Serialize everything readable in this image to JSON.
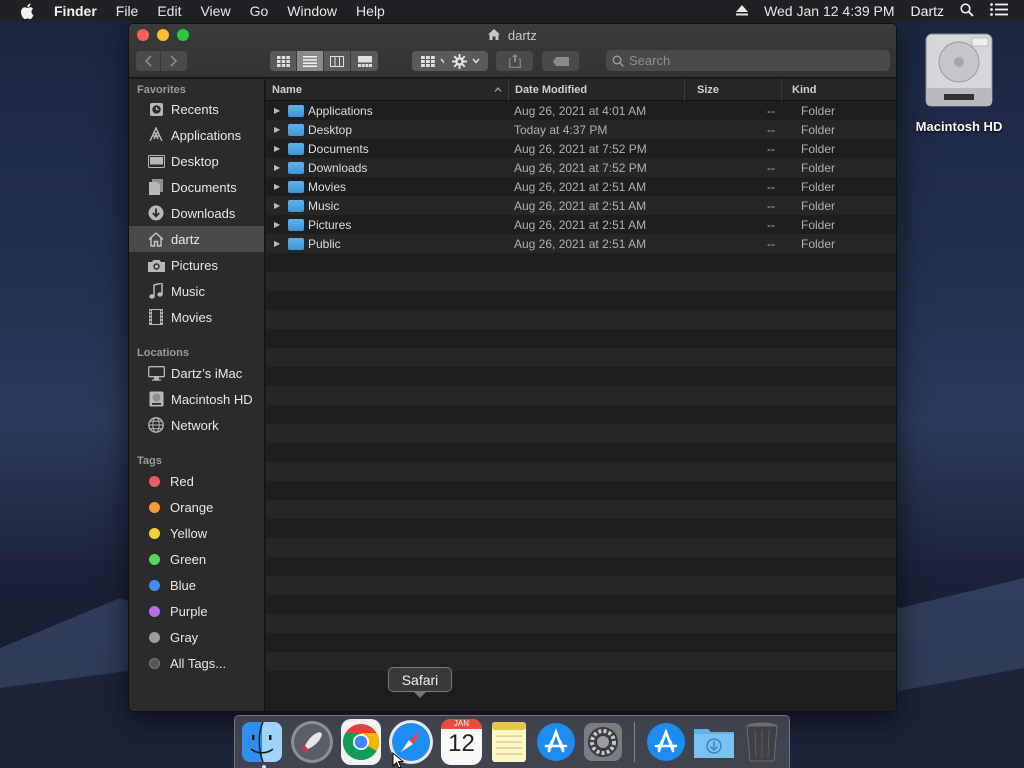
{
  "menubar": {
    "app": "Finder",
    "items": [
      "File",
      "Edit",
      "View",
      "Go",
      "Window",
      "Help"
    ],
    "clock": "Wed Jan 12  4:39 PM",
    "user": "Dartz"
  },
  "window": {
    "title": "dartz",
    "search_placeholder": "Search"
  },
  "sidebar": {
    "favorites_label": "Favorites",
    "favorites": [
      {
        "label": "Recents",
        "icon": "clock-icon"
      },
      {
        "label": "Applications",
        "icon": "applications-icon"
      },
      {
        "label": "Desktop",
        "icon": "desktop-icon"
      },
      {
        "label": "Documents",
        "icon": "document-icon"
      },
      {
        "label": "Downloads",
        "icon": "download-icon"
      },
      {
        "label": "dartz",
        "icon": "home-icon"
      },
      {
        "label": "Pictures",
        "icon": "camera-icon"
      },
      {
        "label": "Music",
        "icon": "music-note-icon"
      },
      {
        "label": "Movies",
        "icon": "film-icon"
      }
    ],
    "locations_label": "Locations",
    "locations": [
      {
        "label": "Dartz’s iMac",
        "icon": "imac-icon"
      },
      {
        "label": "Macintosh HD",
        "icon": "disk-icon"
      },
      {
        "label": "Network",
        "icon": "globe-icon"
      }
    ],
    "tags_label": "Tags",
    "tags": [
      {
        "label": "Red",
        "color": "#ec5c5c"
      },
      {
        "label": "Orange",
        "color": "#f39c3b"
      },
      {
        "label": "Yellow",
        "color": "#f4d03a"
      },
      {
        "label": "Green",
        "color": "#5bd55b"
      },
      {
        "label": "Blue",
        "color": "#3f8ef0"
      },
      {
        "label": "Purple",
        "color": "#b76ee8"
      },
      {
        "label": "Gray",
        "color": "#9c9ca0"
      },
      {
        "label": "All Tags...",
        "color": "#555558"
      }
    ]
  },
  "list": {
    "columns": {
      "name": "Name",
      "date": "Date Modified",
      "size": "Size",
      "kind": "Kind"
    },
    "rows": [
      {
        "name": "Applications",
        "date": "Aug 26, 2021 at 4:01 AM",
        "size": "--",
        "kind": "Folder"
      },
      {
        "name": "Desktop",
        "date": "Today at 4:37 PM",
        "size": "--",
        "kind": "Folder"
      },
      {
        "name": "Documents",
        "date": "Aug 26, 2021 at 7:52 PM",
        "size": "--",
        "kind": "Folder"
      },
      {
        "name": "Downloads",
        "date": "Aug 26, 2021 at 7:52 PM",
        "size": "--",
        "kind": "Folder"
      },
      {
        "name": "Movies",
        "date": "Aug 26, 2021 at 2:51 AM",
        "size": "--",
        "kind": "Folder"
      },
      {
        "name": "Music",
        "date": "Aug 26, 2021 at 2:51 AM",
        "size": "--",
        "kind": "Folder"
      },
      {
        "name": "Pictures",
        "date": "Aug 26, 2021 at 2:51 AM",
        "size": "--",
        "kind": "Folder"
      },
      {
        "name": "Public",
        "date": "Aug 26, 2021 at 2:51 AM",
        "size": "--",
        "kind": "Folder"
      }
    ]
  },
  "desktop": {
    "hd_label": "Macintosh HD"
  },
  "dock": {
    "tooltip": "Safari",
    "calendar_month": "JAN",
    "calendar_day": "12"
  }
}
